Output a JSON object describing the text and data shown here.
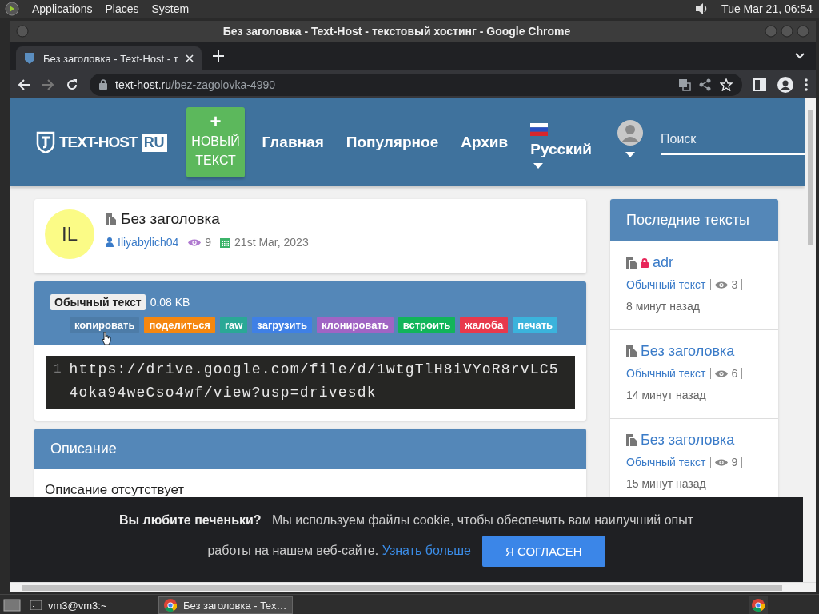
{
  "desktop_panel": {
    "menus": [
      "Applications",
      "Places",
      "System"
    ],
    "clock": "Tue Mar 21, 06:54"
  },
  "window": {
    "title": "Без заголовка - Text-Host - текстовый хостинг - Google Chrome"
  },
  "tabs": [
    {
      "label": "Без заголовка - Text-Host - т",
      "selected": true
    }
  ],
  "address_bar": {
    "host": "text-host.ru",
    "path": "/bez-zagolovka-4990"
  },
  "site_header": {
    "logo": "TEXT-HOST",
    "logo_badge": "RU",
    "new_button": {
      "icon": "+",
      "label": "НОВЫЙ ТЕКСТ"
    },
    "nav": [
      "Главная",
      "Популярное",
      "Архив"
    ],
    "language": "Русский",
    "search": {
      "placeholder": "Поиск"
    }
  },
  "paste": {
    "avatar_initials": "IL",
    "title": "Без заголовка",
    "author": "Iliyabylich04",
    "views": "9",
    "date": "21st Mar, 2023",
    "syntax": "Обычный текст",
    "size": "0.08 KB",
    "actions": [
      {
        "label": "копировать",
        "color": "#4d7ca8"
      },
      {
        "label": "поделиться",
        "color": "#f5870f"
      },
      {
        "label": "raw",
        "color": "#2aa896"
      },
      {
        "label": "загрузить",
        "color": "#3f80e6"
      },
      {
        "label": "клонировать",
        "color": "#a064c4"
      },
      {
        "label": "встроить",
        "color": "#12b55a"
      },
      {
        "label": "жалоба",
        "color": "#e8394c"
      },
      {
        "label": "печать",
        "color": "#3bb3dc"
      }
    ],
    "code_lines": [
      {
        "number": "1",
        "text": "https://drive.google.com/file/d/1wtgTlH8iVYoR8rvLC54oka94weCso4wf/view?usp=drivesdk"
      }
    ]
  },
  "description": {
    "title": "Описание",
    "text": "Описание отсутствует"
  },
  "sidebar": {
    "title": "Последние тексты",
    "items": [
      {
        "title": "adr",
        "locked": true,
        "syntax": "Обычный текст",
        "views": "3",
        "age": "8 минут назад"
      },
      {
        "title": "Без заголовка",
        "locked": false,
        "syntax": "Обычный текст",
        "views": "6",
        "age": "14 минут назад"
      },
      {
        "title": "Без заголовка",
        "locked": false,
        "syntax": "Обычный текст",
        "views": "9",
        "age": "15 минут назад"
      }
    ]
  },
  "cookie_banner": {
    "lines": [
      "**Вы любите печеньки?**   Мы используем файлы cookie, чтобы обеспечить вам наилучший опыт",
      "работы на нашем веб-сайте."
    ],
    "link": "Узнать больше",
    "button": "Я СОГЛАСЕН"
  },
  "taskbar": {
    "items": [
      {
        "label": "vm3@vm3:~",
        "selected": false
      },
      {
        "label": "Без заголовка - Tex…",
        "selected": true
      }
    ]
  }
}
